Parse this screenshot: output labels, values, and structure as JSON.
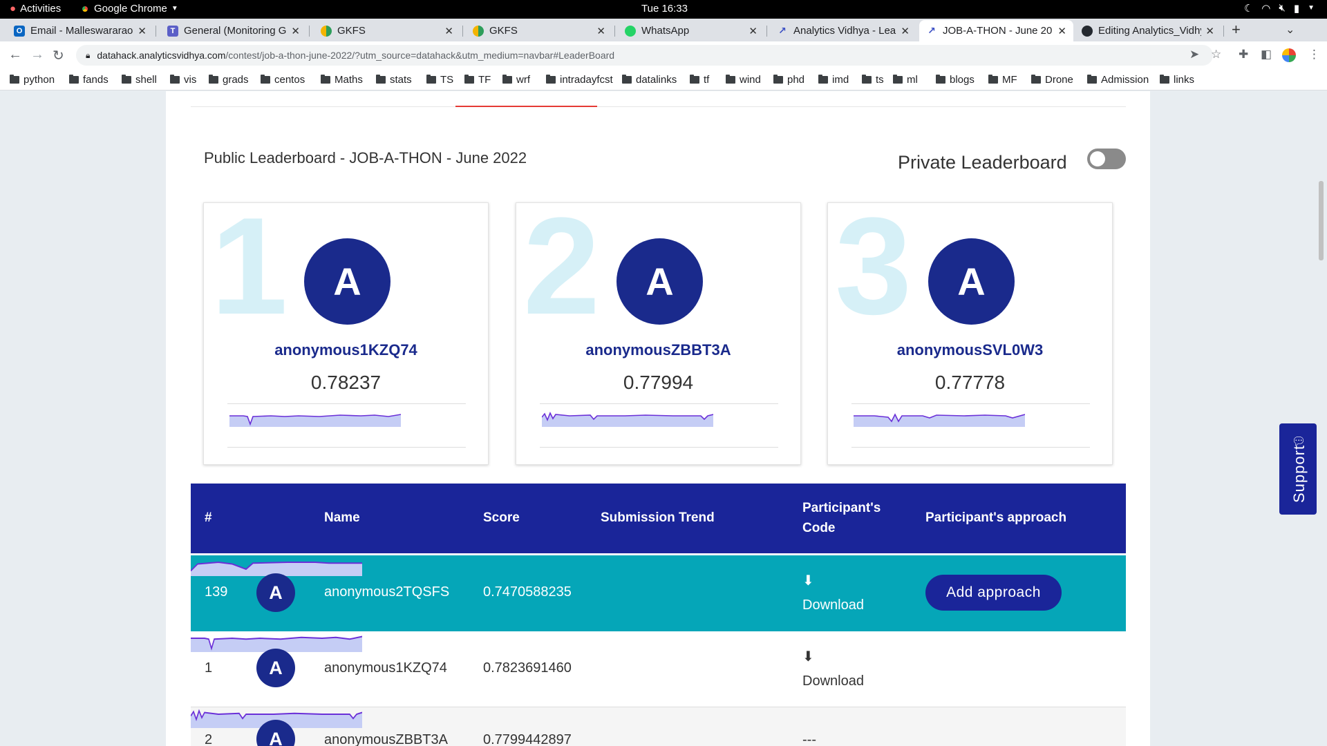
{
  "system": {
    "activities": "Activities",
    "app_name": "Google Chrome",
    "clock": "Tue 16:33"
  },
  "tabs": [
    {
      "title": "Email - Malleswararao M",
      "icon_color": "#0a66c2",
      "icon_letter": "O"
    },
    {
      "title": "General (Monitoring GK",
      "icon_color": "#5b5fc7",
      "icon_letter": "T"
    },
    {
      "title": "GKFS",
      "icon_color": "#2e9e5b",
      "icon_letter": ""
    },
    {
      "title": "GKFS",
      "icon_color": "#2e9e5b",
      "icon_letter": ""
    },
    {
      "title": "WhatsApp",
      "icon_color": "#25d366",
      "icon_letter": ""
    },
    {
      "title": "Analytics Vidhya - Learn",
      "icon_color": "#ffffff",
      "icon_letter": ""
    },
    {
      "title": "JOB-A-THON - June 20",
      "icon_color": "#ffffff",
      "icon_letter": ""
    },
    {
      "title": "Editing Analytics_Vidhya",
      "icon_color": "#24292f",
      "icon_letter": ""
    }
  ],
  "address": {
    "host": "datahack.analyticsvidhya.com",
    "path": "/contest/job-a-thon-june-2022/?utm_source=datahack&utm_medium=navbar#LeaderBoard"
  },
  "bookmarks": [
    "python",
    "fands",
    "shell",
    "vis",
    "grads",
    "centos",
    "Maths",
    "stats",
    "TS",
    "TF",
    "wrf",
    "intradayfcst",
    "datalinks",
    "tf",
    "wind",
    "phd",
    "imd",
    "ts",
    "ml",
    "blogs",
    "MF",
    "Drone",
    "Admission",
    "links"
  ],
  "leaderboard": {
    "title": "Public Leaderboard - JOB-A-THON - June 2022",
    "private_label": "Private Leaderboard",
    "private_on": false
  },
  "podium": [
    {
      "rank": "1",
      "initial": "A",
      "name": "anonymous1KZQ74",
      "score": "0.78237"
    },
    {
      "rank": "2",
      "initial": "A",
      "name": "anonymousZBBT3A",
      "score": "0.77994"
    },
    {
      "rank": "3",
      "initial": "A",
      "name": "anonymousSVL0W3",
      "score": "0.77778"
    }
  ],
  "table": {
    "headers": {
      "rank": "#",
      "name": "Name",
      "score": "Score",
      "trend": "Submission Trend",
      "code_l1": "Participant's",
      "code_l2": "Code",
      "approach": "Participant's approach"
    },
    "rows": [
      {
        "rank": "139",
        "initial": "A",
        "name": "anonymous2TQSFS",
        "score": "0.7470588235",
        "code": "Download",
        "approach": "Add approach"
      },
      {
        "rank": "1",
        "initial": "A",
        "name": "anonymous1KZQ74",
        "score": "0.7823691460",
        "code": "Download",
        "approach": ""
      },
      {
        "rank": "2",
        "initial": "A",
        "name": "anonymousZBBT3A",
        "score": "0.7799442897",
        "code": "---",
        "approach": ""
      }
    ]
  },
  "support": {
    "label": "Support"
  },
  "colors": {
    "brand": "#1a2599",
    "highlight_row": "#05a6b8",
    "rank_watermark": "#d6f0f7",
    "trend_fill": "#c5cdf5",
    "trend_line": "#6a2fd8"
  }
}
